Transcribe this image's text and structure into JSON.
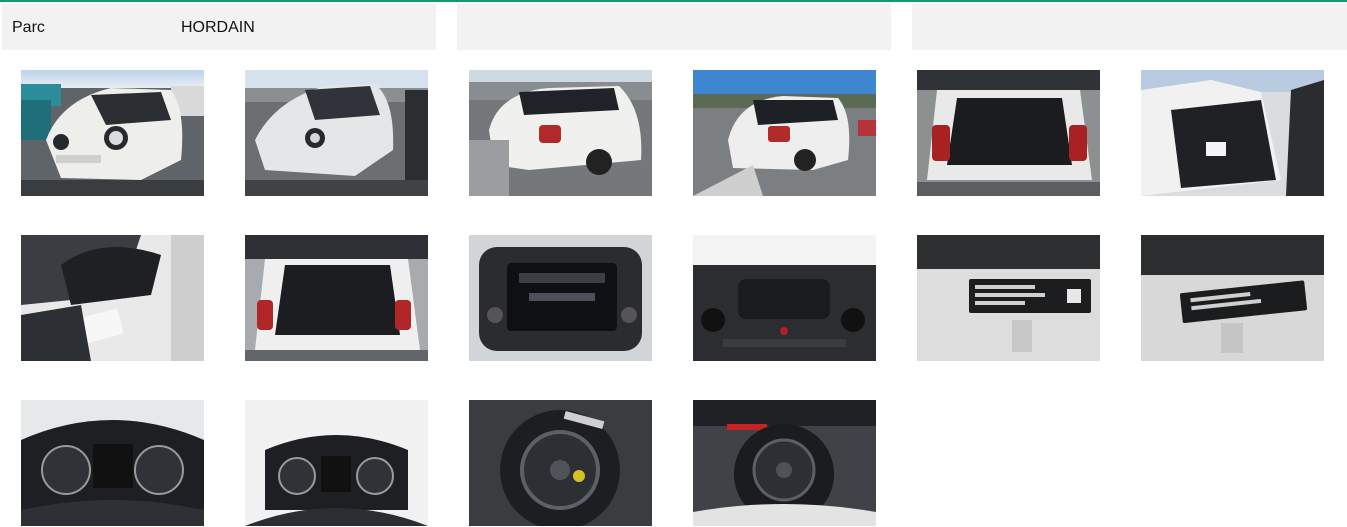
{
  "header": {
    "parc_label": "Parc",
    "parc_value": "HORDAIN"
  },
  "colors": {
    "accent": "#13996b",
    "panel_bg": "#f2f2f2"
  },
  "photos": [
    {
      "name": "car-front-left-photo",
      "icon": "car-front-icon"
    },
    {
      "name": "car-front-right-photo",
      "icon": "car-front-icon"
    },
    {
      "name": "car-rear-right-photo",
      "icon": "car-rear-icon"
    },
    {
      "name": "car-rear-left-photo",
      "icon": "car-rear-icon"
    },
    {
      "name": "trunk-open-photo",
      "icon": "trunk-icon"
    },
    {
      "name": "rear-door-interior-photo",
      "icon": "door-icon"
    },
    {
      "name": "front-seat-interior-photo",
      "icon": "seat-icon"
    },
    {
      "name": "trunk-open-close-photo",
      "icon": "trunk-icon"
    },
    {
      "name": "infotainment-screen-photo",
      "icon": "screen-icon"
    },
    {
      "name": "dashboard-center-photo",
      "icon": "dashboard-icon"
    },
    {
      "name": "vin-label-photo",
      "icon": "label-icon"
    },
    {
      "name": "vin-label-closeup-photo",
      "icon": "label-icon"
    },
    {
      "name": "instrument-cluster-photo",
      "icon": "gauge-icon"
    },
    {
      "name": "instrument-cluster-wide-photo",
      "icon": "gauge-icon"
    },
    {
      "name": "spare-wheel-photo",
      "icon": "wheel-icon"
    },
    {
      "name": "spare-wheel-well-photo",
      "icon": "wheel-icon"
    }
  ]
}
